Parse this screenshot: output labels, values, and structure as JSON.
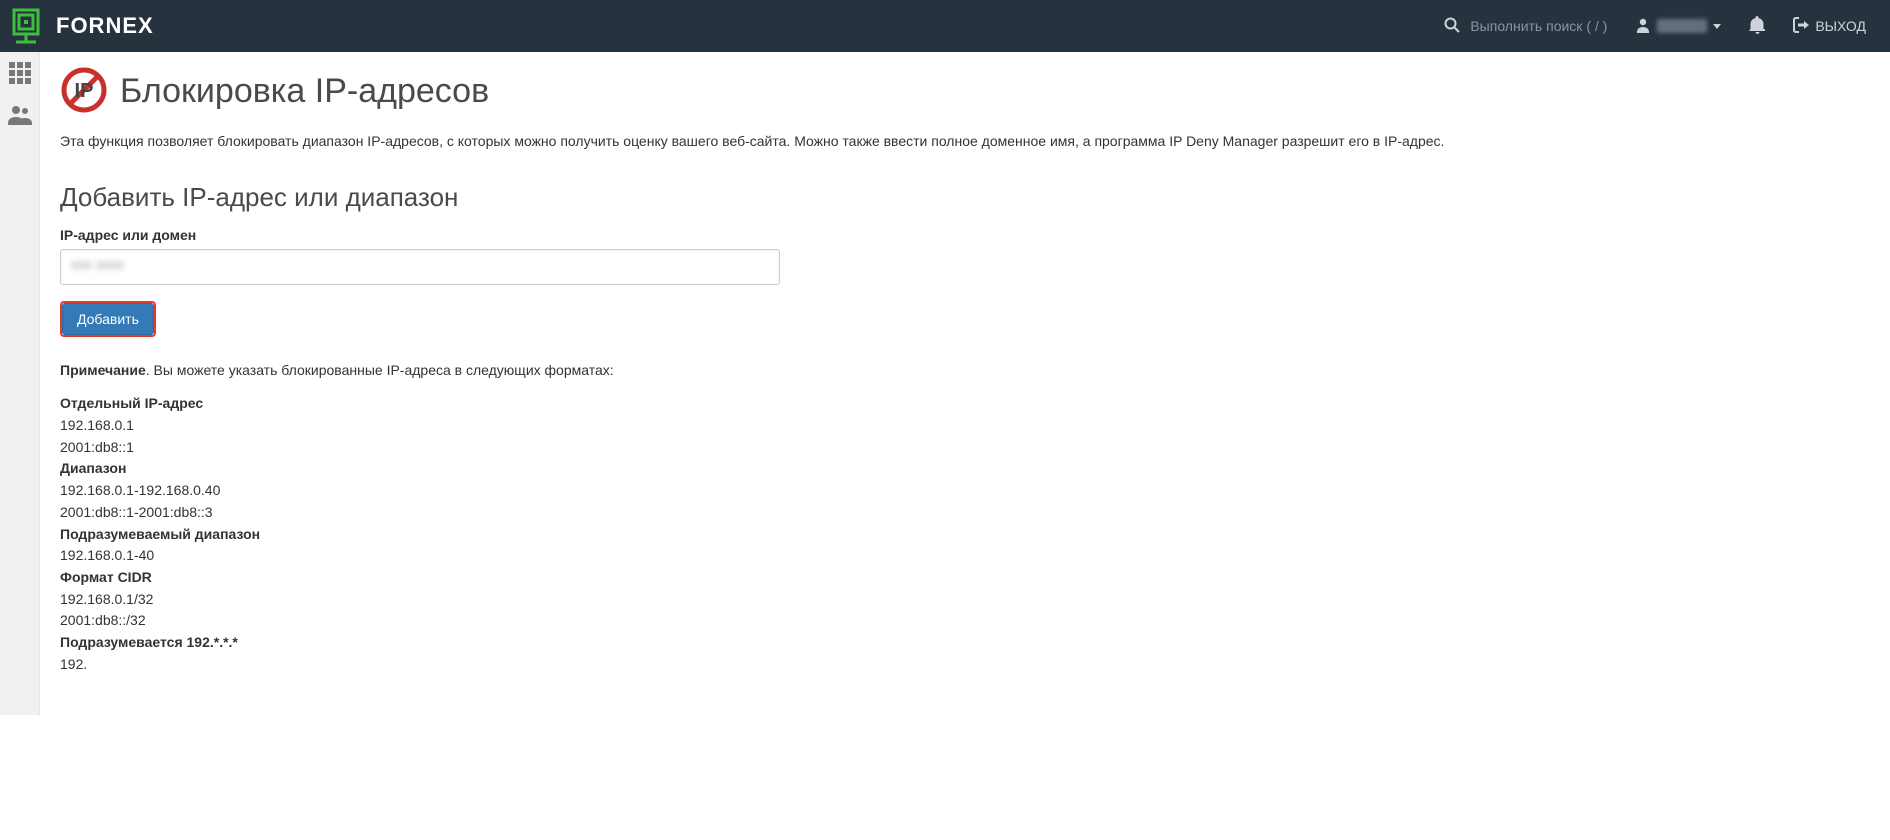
{
  "header": {
    "brand": "FORNEX",
    "search_placeholder": "Выполнить поиск ( / )",
    "logout_label": "ВЫХОД"
  },
  "page": {
    "title": "Блокировка IP-адресов",
    "description": "Эта функция позволяет блокировать диапазон IP-адресов, с которых можно получить оценку вашего веб-сайта. Можно также ввести полное доменное имя, а программа IP Deny Manager разрешит его в IP-адрес.",
    "section_title": "Добавить IP-адрес или диапазон",
    "input_label": "IP-адрес или домен",
    "input_value_obscured": "xxx xxxx",
    "add_button": "Добавить",
    "note_label": "Примечание",
    "note_text": ". Вы можете указать блокированные IP-адреса в следующих форматах:",
    "formats": [
      {
        "title": "Отдельный IP-адрес",
        "lines": [
          "192.168.0.1",
          "2001:db8::1"
        ]
      },
      {
        "title": "Диапазон",
        "lines": [
          "192.168.0.1-192.168.0.40",
          "2001:db8::1-2001:db8::3"
        ]
      },
      {
        "title": "Подразумеваемый диапазон",
        "lines": [
          "192.168.0.1-40"
        ]
      },
      {
        "title": "Формат CIDR",
        "lines": [
          "192.168.0.1/32",
          "2001:db8::/32"
        ]
      },
      {
        "title": "Подразумевается 192.*.*.*",
        "lines": [
          "192."
        ]
      }
    ]
  }
}
